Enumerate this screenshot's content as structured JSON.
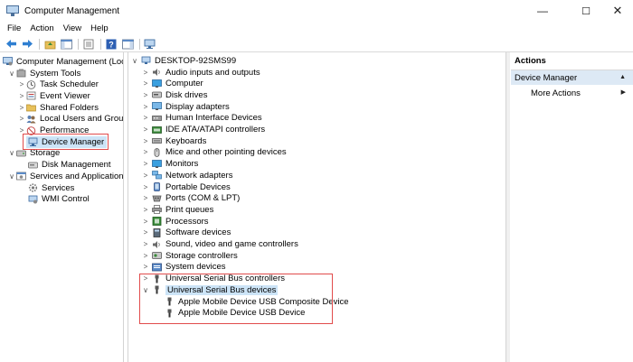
{
  "window": {
    "title": "Computer Management"
  },
  "menu": [
    "File",
    "Action",
    "View",
    "Help"
  ],
  "left_tree": [
    {
      "label": "Computer Management (Local",
      "indent": 0,
      "expander": "",
      "icon": "computer-management-icon"
    },
    {
      "label": "System Tools",
      "indent": 1,
      "expander": "∨",
      "icon": "system-tools-icon"
    },
    {
      "label": "Task Scheduler",
      "indent": 2,
      "expander": ">",
      "icon": "clock-icon"
    },
    {
      "label": "Event Viewer",
      "indent": 2,
      "expander": ">",
      "icon": "event-viewer-icon"
    },
    {
      "label": "Shared Folders",
      "indent": 2,
      "expander": ">",
      "icon": "folder-icon"
    },
    {
      "label": "Local Users and Groups",
      "indent": 2,
      "expander": ">",
      "icon": "users-icon"
    },
    {
      "label": "Performance",
      "indent": 2,
      "expander": ">",
      "icon": "performance-icon"
    },
    {
      "label": "Device Manager",
      "indent": 2,
      "expander": "",
      "icon": "device-manager-icon",
      "selected": true
    },
    {
      "label": "Storage",
      "indent": 1,
      "expander": "∨",
      "icon": "storage-icon"
    },
    {
      "label": "Disk Management",
      "indent": 2,
      "expander": "",
      "icon": "disk-icon"
    },
    {
      "label": "Services and Applications",
      "indent": 1,
      "expander": "∨",
      "icon": "services-apps-icon"
    },
    {
      "label": "Services",
      "indent": 2,
      "expander": "",
      "icon": "gear-icon"
    },
    {
      "label": "WMI Control",
      "indent": 2,
      "expander": "",
      "icon": "wmi-icon"
    }
  ],
  "device_tree": {
    "root": "DESKTOP-92SMS99",
    "items": [
      {
        "label": "Audio inputs and outputs",
        "expander": ">",
        "icon": "speaker-icon"
      },
      {
        "label": "Computer",
        "expander": ">",
        "icon": "monitor-icon"
      },
      {
        "label": "Disk drives",
        "expander": ">",
        "icon": "disk-drive-icon"
      },
      {
        "label": "Display adapters",
        "expander": ">",
        "icon": "display-adapter-icon"
      },
      {
        "label": "Human Interface Devices",
        "expander": ">",
        "icon": "hid-icon"
      },
      {
        "label": "IDE ATA/ATAPI controllers",
        "expander": ">",
        "icon": "ide-icon"
      },
      {
        "label": "Keyboards",
        "expander": ">",
        "icon": "keyboard-icon"
      },
      {
        "label": "Mice and other pointing devices",
        "expander": ">",
        "icon": "mouse-icon"
      },
      {
        "label": "Monitors",
        "expander": ">",
        "icon": "monitor-icon"
      },
      {
        "label": "Network adapters",
        "expander": ">",
        "icon": "network-icon"
      },
      {
        "label": "Portable Devices",
        "expander": ">",
        "icon": "portable-device-icon"
      },
      {
        "label": "Ports (COM & LPT)",
        "expander": ">",
        "icon": "port-icon"
      },
      {
        "label": "Print queues",
        "expander": ">",
        "icon": "printer-icon"
      },
      {
        "label": "Processors",
        "expander": ">",
        "icon": "processor-icon"
      },
      {
        "label": "Software devices",
        "expander": ">",
        "icon": "software-device-icon"
      },
      {
        "label": "Sound, video and game controllers",
        "expander": ">",
        "icon": "speaker-icon"
      },
      {
        "label": "Storage controllers",
        "expander": ">",
        "icon": "storage-controller-icon"
      },
      {
        "label": "System devices",
        "expander": ">",
        "icon": "system-device-icon"
      },
      {
        "label": "Universal Serial Bus controllers",
        "expander": ">",
        "icon": "usb-icon"
      },
      {
        "label": "Universal Serial Bus devices",
        "expander": "∨",
        "icon": "usb-icon",
        "selected": true
      },
      {
        "label": "Apple Mobile Device USB Composite Device",
        "expander": "",
        "icon": "usb-plug-icon",
        "child": true
      },
      {
        "label": "Apple Mobile Device USB Device",
        "expander": "",
        "icon": "usb-plug-icon",
        "child": true
      }
    ]
  },
  "actions": {
    "header": "Actions",
    "section": "Device Manager",
    "items": [
      "More Actions"
    ]
  },
  "colors": {
    "selection": "#cce4f7",
    "highlight_box": "#e14c4c",
    "section_bg": "#dde9f5"
  }
}
